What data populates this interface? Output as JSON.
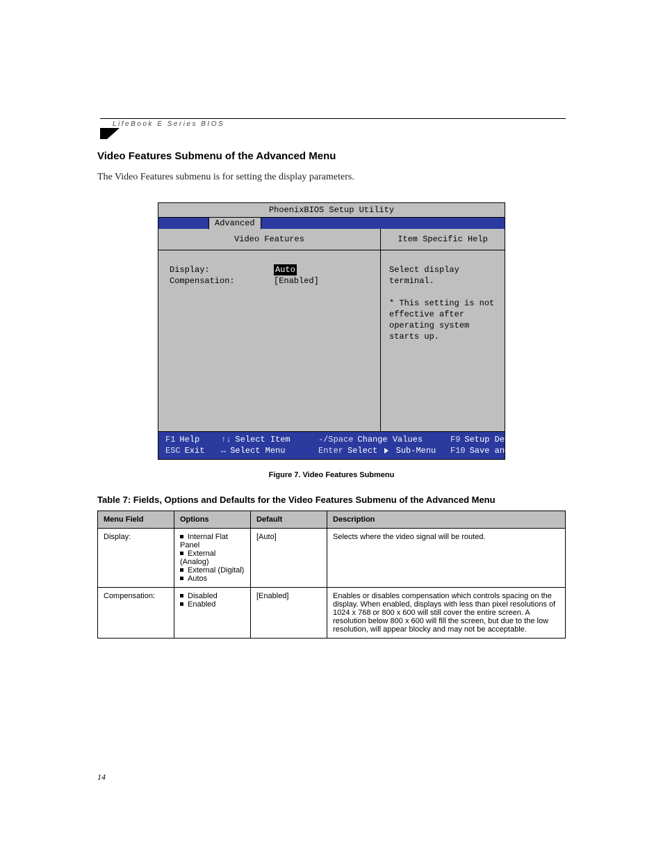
{
  "running_title": "LifeBook E Series BIOS",
  "section_heading": "Video Features Submenu of the Advanced Menu",
  "intro_text": "The Video Features submenu is for setting the display parameters.",
  "bios": {
    "utility_title": "PhoenixBIOS Setup Utility",
    "active_menu": "Advanced",
    "panel_title_left": "Video Features",
    "panel_title_right": "Item Specific Help",
    "fields": [
      {
        "label": "Display:",
        "value": "Auto",
        "selected": true
      },
      {
        "label": "Compensation:",
        "value": "[Enabled]",
        "selected": false
      }
    ],
    "help_lines": [
      "Select display terminal.",
      "",
      "* This setting is not",
      "effective after",
      "operating system",
      "starts up."
    ],
    "footer": {
      "row1": {
        "k1": "F1",
        "a1": "Help",
        "k2": "↑↓",
        "a2": "Select Item",
        "k3": "-/Space",
        "a3": "Change Values",
        "k4": "F9",
        "a4": "Setup Defaults"
      },
      "row2": {
        "k1": "ESC",
        "a1": "Exit",
        "k2": "↔",
        "a2": "Select Menu",
        "k3": "Enter",
        "a3": "Select ▶ Sub-Menu",
        "k4": "F10",
        "a4": "Save and Exit"
      }
    }
  },
  "figure_caption": "Figure 7.  Video Features Submenu",
  "table_title": "Table 7: Fields, Options and Defaults for the Video Features Submenu of the Advanced Menu",
  "table": {
    "headers": [
      "Menu Field",
      "Options",
      "Default",
      "Description"
    ],
    "rows": [
      {
        "field": "Display:",
        "options": [
          "Internal Flat Panel",
          "External (Analog)",
          "External (Digital)",
          "Autos"
        ],
        "default": "[Auto]",
        "description": "Selects where the video signal will be routed."
      },
      {
        "field": "Compensation:",
        "options": [
          "Disabled",
          "Enabled"
        ],
        "default": "[Enabled]",
        "description": "Enables or disables compensation which controls spacing on the display. When enabled, displays with less than pixel resolutions of 1024 x 768 or 800 x 600 will still cover the entire screen. A resolution below 800 x 600 will fill the screen, but due to the low resolution, will appear blocky and may not be acceptable."
      }
    ]
  },
  "page_number": "14"
}
